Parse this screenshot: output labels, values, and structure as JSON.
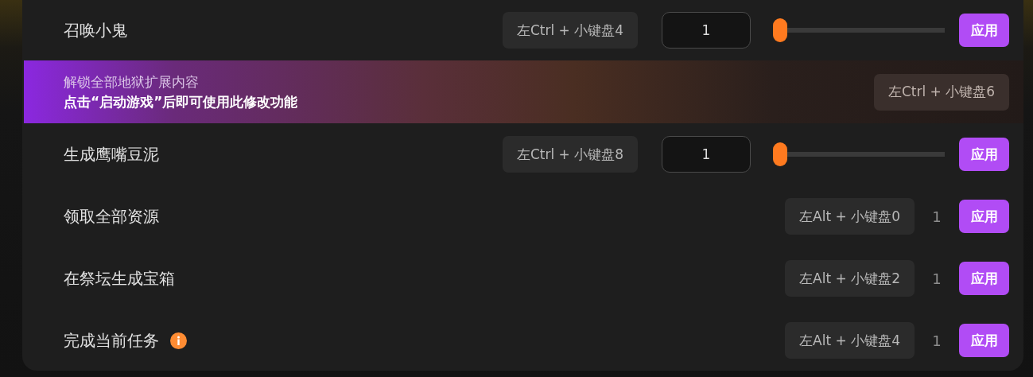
{
  "rows": [
    {
      "kind": "slider",
      "label": "召唤小鬼",
      "hotkey": "左Ctrl + 小键盘4",
      "value": "1",
      "level": 0,
      "button": "应用"
    },
    {
      "kind": "locked",
      "title": "解锁全部地狱扩展内容",
      "message": "点击“启动游戏”后即可使用此修改功能",
      "hotkey": "左Ctrl + 小键盘6"
    },
    {
      "kind": "slider",
      "label": "生成鹰嘴豆泥",
      "hotkey": "左Ctrl + 小键盘8",
      "value": "1",
      "level": 0,
      "button": "应用"
    },
    {
      "kind": "count",
      "label": "领取全部资源",
      "hotkey": "左Alt + 小键盘0",
      "count": "1",
      "button": "应用"
    },
    {
      "kind": "count",
      "label": "在祭坛生成宝箱",
      "hotkey": "左Alt + 小键盘2",
      "count": "1",
      "button": "应用"
    },
    {
      "kind": "count",
      "label": "完成当前任务",
      "info": true,
      "hotkey": "左Alt + 小键盘4",
      "count": "1",
      "button": "应用"
    }
  ]
}
